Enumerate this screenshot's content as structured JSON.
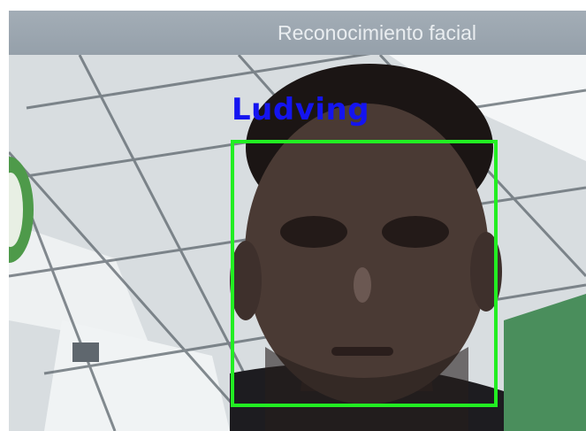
{
  "window": {
    "title": "Reconocimiento facial"
  },
  "detection": {
    "name": "Ludving",
    "box_color": "#22ee22",
    "label_color": "#1414f0"
  }
}
